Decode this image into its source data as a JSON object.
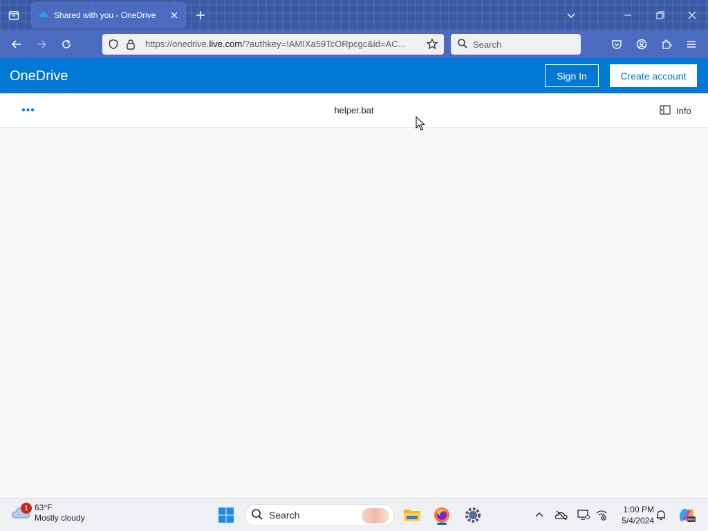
{
  "browser": {
    "tab": {
      "title": "Shared with you - OneDrive"
    },
    "url": {
      "prefix": "https://onedrive.",
      "domain": "live.com",
      "rest": "/?authkey=!AMIXa59TcORpcgc&id=AC..."
    },
    "search": {
      "placeholder": "Search"
    }
  },
  "onedrive": {
    "brand": "OneDrive",
    "sign_in": "Sign In",
    "create_account": "Create account",
    "more_label": "•••",
    "filename": "helper.bat",
    "info": "Info",
    "brand_color": "#0078d4"
  },
  "taskbar": {
    "weather": {
      "temp": "63°F",
      "condition": "Mostly cloudy",
      "badge": "1"
    },
    "search": "Search",
    "time": "1:00 PM",
    "date": "5/4/2024"
  }
}
